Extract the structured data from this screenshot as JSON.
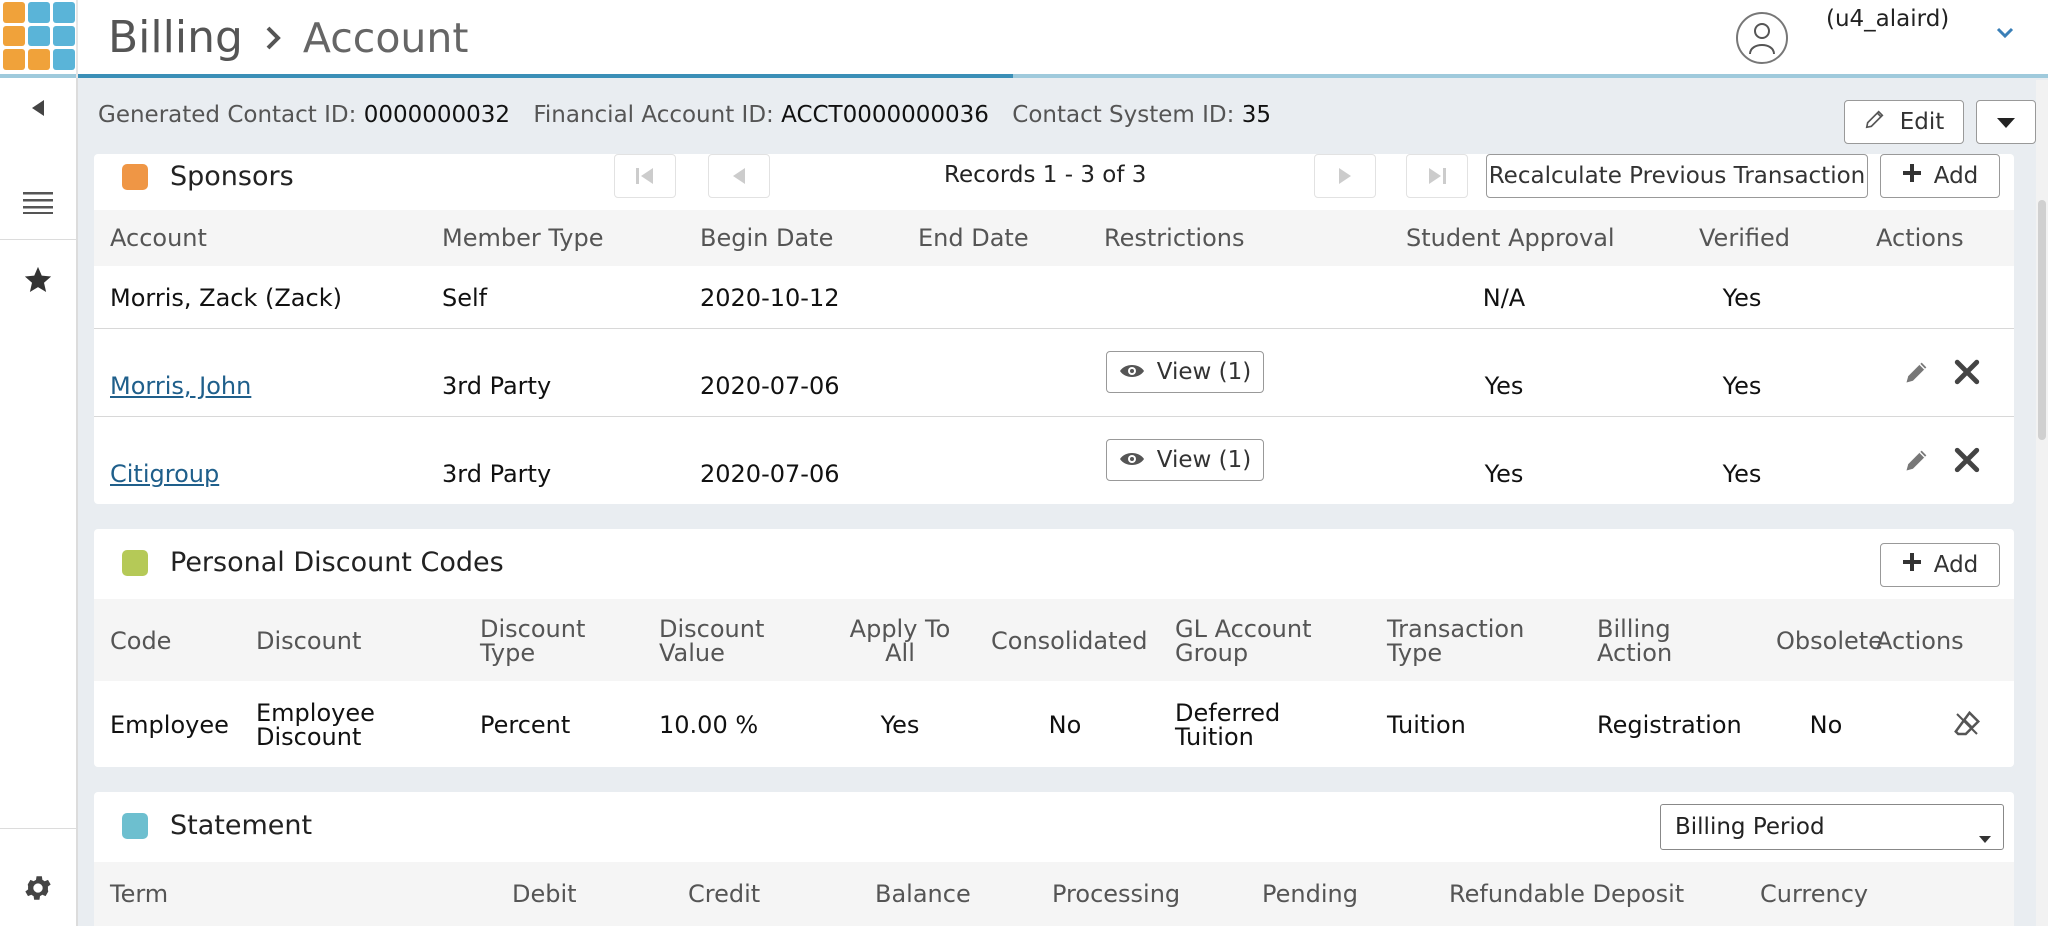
{
  "header": {
    "breadcrumb": [
      "Billing",
      "Account"
    ],
    "username": "(u4_alaird)",
    "logo_colors": [
      "#f0a23a",
      "#5ab4d8",
      "#5ab4d8",
      "#f0a23a",
      "#5ab4d8",
      "#5ab4d8",
      "#f0a23a",
      "#f0a23a",
      "#5ab4d8"
    ]
  },
  "info": {
    "fields": [
      {
        "label": "Generated Contact ID:",
        "value": "0000000032"
      },
      {
        "label": "Financial Account ID:",
        "value": "ACCT0000000036"
      },
      {
        "label": "Contact System ID:",
        "value": "35"
      }
    ],
    "edit_label": "Edit"
  },
  "sponsors": {
    "title": "Sponsors",
    "color": "#ef9645",
    "records_text": "Records 1 - 3 of 3",
    "recalc_label": "Recalculate Previous Transaction",
    "add_label": "Add",
    "columns": [
      "Account",
      "Member Type",
      "Begin Date",
      "End Date",
      "Restrictions",
      "Student Approval",
      "Verified",
      "Actions"
    ],
    "rows": [
      {
        "account": "Morris, Zack (Zack)",
        "member_type": "Self",
        "begin": "2020-10-12",
        "end": "",
        "restrictions": "",
        "approval": "N/A",
        "verified": "Yes"
      },
      {
        "account": "Morris, John",
        "member_type": "3rd Party",
        "begin": "2020-07-06",
        "end": "",
        "restrictions": "View (1)",
        "approval": "Yes",
        "verified": "Yes"
      },
      {
        "account": "Citigroup",
        "member_type": "3rd Party",
        "begin": "2020-07-06",
        "end": "",
        "restrictions": "View (1)",
        "approval": "Yes",
        "verified": "Yes"
      }
    ]
  },
  "discounts": {
    "title": "Personal Discount Codes",
    "color": "#b5c957",
    "add_label": "Add",
    "columns": {
      "code": [
        "Code"
      ],
      "discount": [
        "Discount"
      ],
      "discount_type": [
        "Discount",
        "Type"
      ],
      "discount_value": [
        "Discount",
        "Value"
      ],
      "apply_all": [
        "Apply To",
        "All"
      ],
      "consolidated": [
        "Consolidated"
      ],
      "gl_group": [
        "GL Account",
        "Group"
      ],
      "txn_type": [
        "Transaction",
        "Type"
      ],
      "billing_action": [
        "Billing",
        "Action"
      ],
      "obsolete": [
        "Obsolete"
      ],
      "actions": [
        "Actions"
      ]
    },
    "row": {
      "code": "Employee",
      "discount": [
        "Employee",
        "Discount"
      ],
      "discount_type": "Percent",
      "discount_value": "10.00 %",
      "apply_all": "Yes",
      "consolidated": "No",
      "gl_group": [
        "Deferred",
        "Tuition"
      ],
      "txn_type": "Tuition",
      "billing_action": "Registration",
      "obsolete": "No"
    }
  },
  "statement": {
    "title": "Statement",
    "color": "#6dbfcf",
    "select_value": "Billing Period",
    "columns": [
      "Term",
      "Debit",
      "Credit",
      "Balance",
      "Processing",
      "Pending",
      "Refundable Deposit",
      "Currency"
    ]
  }
}
